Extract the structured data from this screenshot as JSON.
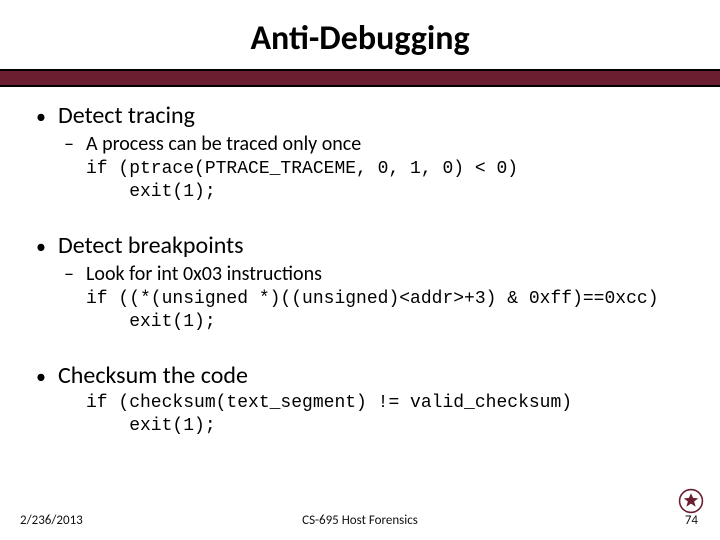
{
  "title": "Anti-Debugging",
  "sections": [
    {
      "heading": "Detect tracing",
      "sub": "A process can be traced only once",
      "code": "if (ptrace(PTRACE_TRACEME, 0, 1, 0) < 0)\n    exit(1);"
    },
    {
      "heading": "Detect breakpoints",
      "sub": "Look for int 0x03 instructions",
      "code": "if ((*(unsigned *)((unsigned)<addr>+3) & 0xff)==0xcc)\n    exit(1);"
    },
    {
      "heading": "Checksum the code",
      "sub": null,
      "code": "if (checksum(text_segment) != valid_checksum)\n    exit(1);"
    }
  ],
  "footer": {
    "date": "2/236/2013",
    "center": "CS-695 Host Forensics",
    "page": "74"
  },
  "colors": {
    "bar": "#6b1e2f"
  }
}
